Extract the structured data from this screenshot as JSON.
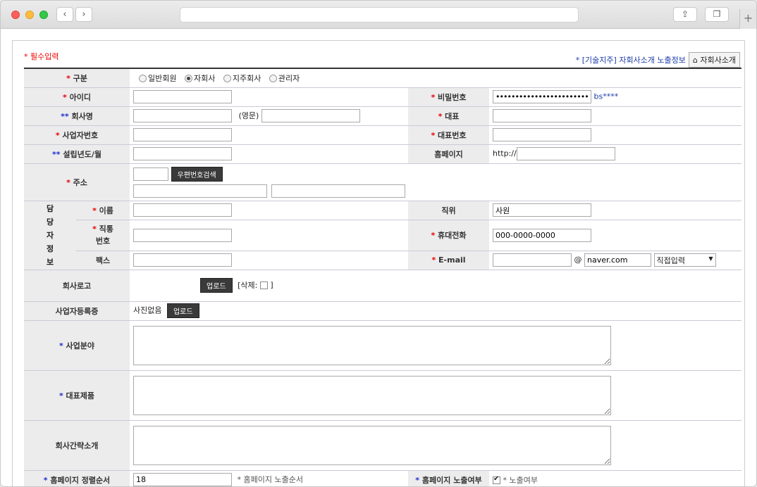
{
  "header": {
    "required_note": "* 필수입력",
    "info_link": "* [기술지주] 자회사소개 노출정보",
    "intro_button": "자회사소개"
  },
  "fields": {
    "category": {
      "label": "구분",
      "options": [
        "일반회원",
        "자회사",
        "지주회사",
        "관리자"
      ],
      "selected": "자회사"
    },
    "user_id": {
      "label": "아이디",
      "value": ""
    },
    "password": {
      "label": "비밀번호",
      "value": "•••••••••••••••••••••••••••••••••••••••••",
      "hint": "bs****"
    },
    "company_name": {
      "label": "회사명",
      "value": "",
      "eng_label": "(영문)",
      "eng_value": ""
    },
    "ceo": {
      "label": "대표",
      "value": ""
    },
    "biz_number": {
      "label": "사업자번호",
      "value": ""
    },
    "ceo_phone": {
      "label": "대표번호",
      "value": ""
    },
    "founded": {
      "label": "설립년도/월",
      "value": ""
    },
    "homepage": {
      "label": "홈페이지",
      "prefix": "http://",
      "value": ""
    },
    "address": {
      "label": "주소",
      "zip_button": "우편번호검색"
    },
    "contact": {
      "group_label": [
        "담",
        "당",
        "자",
        "정",
        "보"
      ],
      "name": {
        "label": "이름",
        "value": ""
      },
      "position": {
        "label": "직위",
        "value": "사원"
      },
      "direct": {
        "label": "직통",
        "label2": "번호",
        "value": ""
      },
      "mobile": {
        "label": "휴대전화",
        "value": "000-0000-0000"
      },
      "fax": {
        "label": "팩스",
        "value": ""
      },
      "email": {
        "label": "E-mail",
        "at": "@",
        "domain": "naver.com",
        "select": "직접입력"
      }
    },
    "logo": {
      "label": "회사로고",
      "upload": "업로드",
      "delete_label": "[삭제:",
      "delete_close": "]"
    },
    "biz_cert": {
      "label": "사업자등록증",
      "status": "사진없음",
      "upload": "업로드"
    },
    "biz_field": {
      "label": "사업분야"
    },
    "main_product": {
      "label": "대표제품"
    },
    "company_intro": {
      "label": "회사간략소개"
    },
    "sort_order": {
      "label": "홈페이지 정렬순서",
      "value": "18",
      "note": "* 홈페이지 노출순서"
    },
    "exposure": {
      "label": "홈페이지 노출여부",
      "note": "* 노출여부",
      "checked": true
    }
  }
}
